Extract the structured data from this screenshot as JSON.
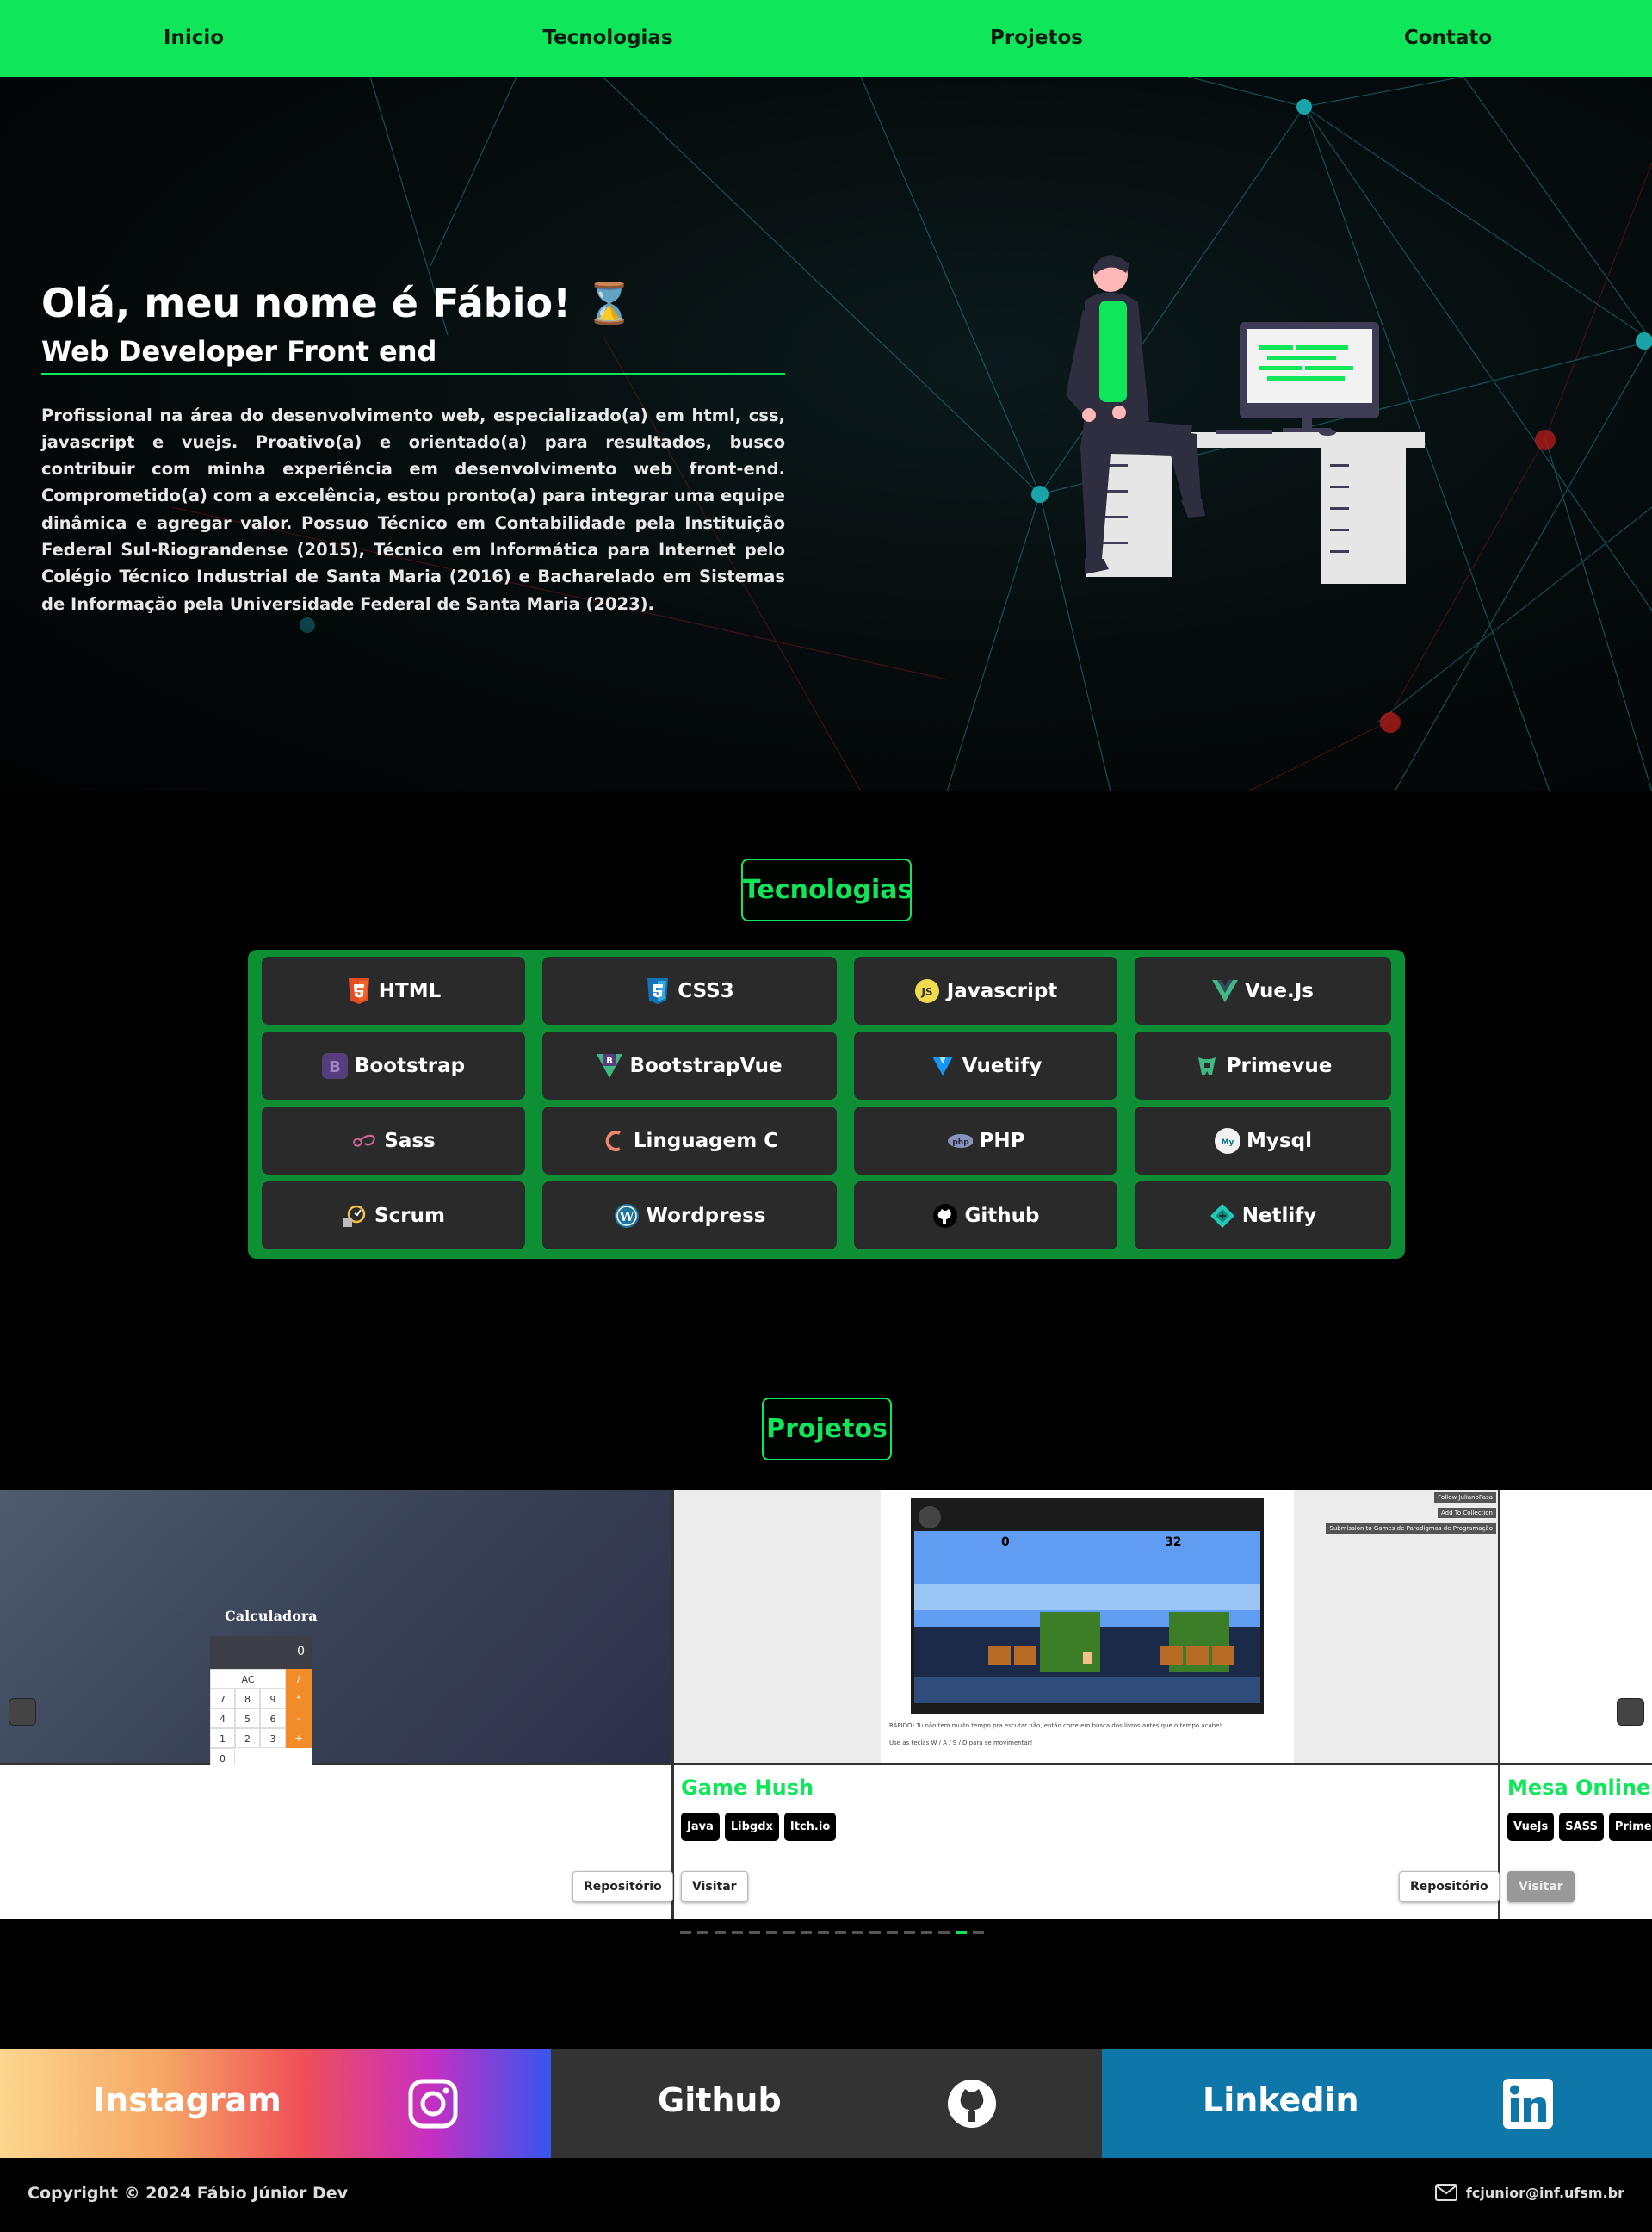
{
  "nav": {
    "items": [
      "Inicio",
      "Tecnologias",
      "Projetos",
      "Contato"
    ]
  },
  "hero": {
    "title": "Olá, meu nome é Fábio! ⌛",
    "subtitle": "Web Developer Front end",
    "description": "Profissional na área do desenvolvimento web, especializado(a) em html, css, javascript e vuejs. Proativo(a) e orientado(a) para resultados, busco contribuir com minha experiência em desenvolvimento web front-end. Comprometido(a) com a excelência, estou pronto(a) para integrar uma equipe dinâmica e agregar valor. Possuo Técnico em Contabilidade pela Instituição Federal Sul-Riograndense (2015), Técnico em Informática para Internet pelo Colégio Técnico Industrial de Santa Maria (2016) e Bacharelado em Sistemas de Informação pela Universidade Federal de Santa Maria (2023)."
  },
  "technologies": {
    "title": "Tecnologias",
    "items": [
      {
        "label": "HTML",
        "icon": "html5-icon"
      },
      {
        "label": "CSS3",
        "icon": "css3-icon"
      },
      {
        "label": "Javascript",
        "icon": "javascript-icon"
      },
      {
        "label": "Vue.Js",
        "icon": "vue-icon"
      },
      {
        "label": "Bootstrap",
        "icon": "bootstrap-icon"
      },
      {
        "label": "BootstrapVue",
        "icon": "bootstrapvue-icon"
      },
      {
        "label": "Vuetify",
        "icon": "vuetify-icon"
      },
      {
        "label": "Primevue",
        "icon": "primevue-icon"
      },
      {
        "label": "Sass",
        "icon": "sass-icon"
      },
      {
        "label": "Linguagem C",
        "icon": "c-language-icon"
      },
      {
        "label": "PHP",
        "icon": "php-icon"
      },
      {
        "label": "Mysql",
        "icon": "mysql-icon"
      },
      {
        "label": "Scrum",
        "icon": "scrum-icon"
      },
      {
        "label": "Wordpress",
        "icon": "wordpress-icon"
      },
      {
        "label": "Github",
        "icon": "github-icon"
      },
      {
        "label": "Netlify",
        "icon": "netlify-icon"
      }
    ]
  },
  "projects": {
    "title": "Projetos",
    "calculator": {
      "title": "Calculadora",
      "display": "0",
      "keys": [
        "AC",
        "/",
        "7",
        "8",
        "9",
        "*",
        "4",
        "5",
        "6",
        "-",
        "1",
        "2",
        "3",
        "+",
        "0"
      ],
      "button": "Repositório"
    },
    "game": {
      "title": "Game Hush",
      "tags": [
        "Java",
        "Libgdx",
        "Itch.io"
      ],
      "visit": "Visitar",
      "repo": "Repositório",
      "score_left": "0",
      "score_right": "32",
      "side_buttons": [
        "Follow JulianoPasa",
        "Add To Collection",
        "Submission to Games de Paradigmas de Programação"
      ],
      "caption_1": "RÁPIDO! Tu não tem muito tempo pra escutar não, então corre em busca dos livros antes que o tempo acabe!",
      "caption_2": "Use as teclas W / A / S / D para se movimentar!"
    },
    "mesa": {
      "title": "Mesa Online",
      "tags": [
        "VueJs",
        "SASS",
        "Primevue"
      ],
      "visit": "Visitar"
    },
    "dots_total": 18,
    "dots_active": 17
  },
  "social": {
    "instagram": "Instagram",
    "github": "Github",
    "linkedin": "Linkedin"
  },
  "footer": {
    "copyright": "Copyright © 2024 Fábio Júnior Dev",
    "email": "fcjunior@inf.ufsm.br"
  },
  "colors": {
    "accent": "#10e65a",
    "tech_box": "#0e8f35",
    "tech_item": "#2a2a2a",
    "github_bg": "#333333",
    "linkedin_bg": "#0e76a8"
  }
}
